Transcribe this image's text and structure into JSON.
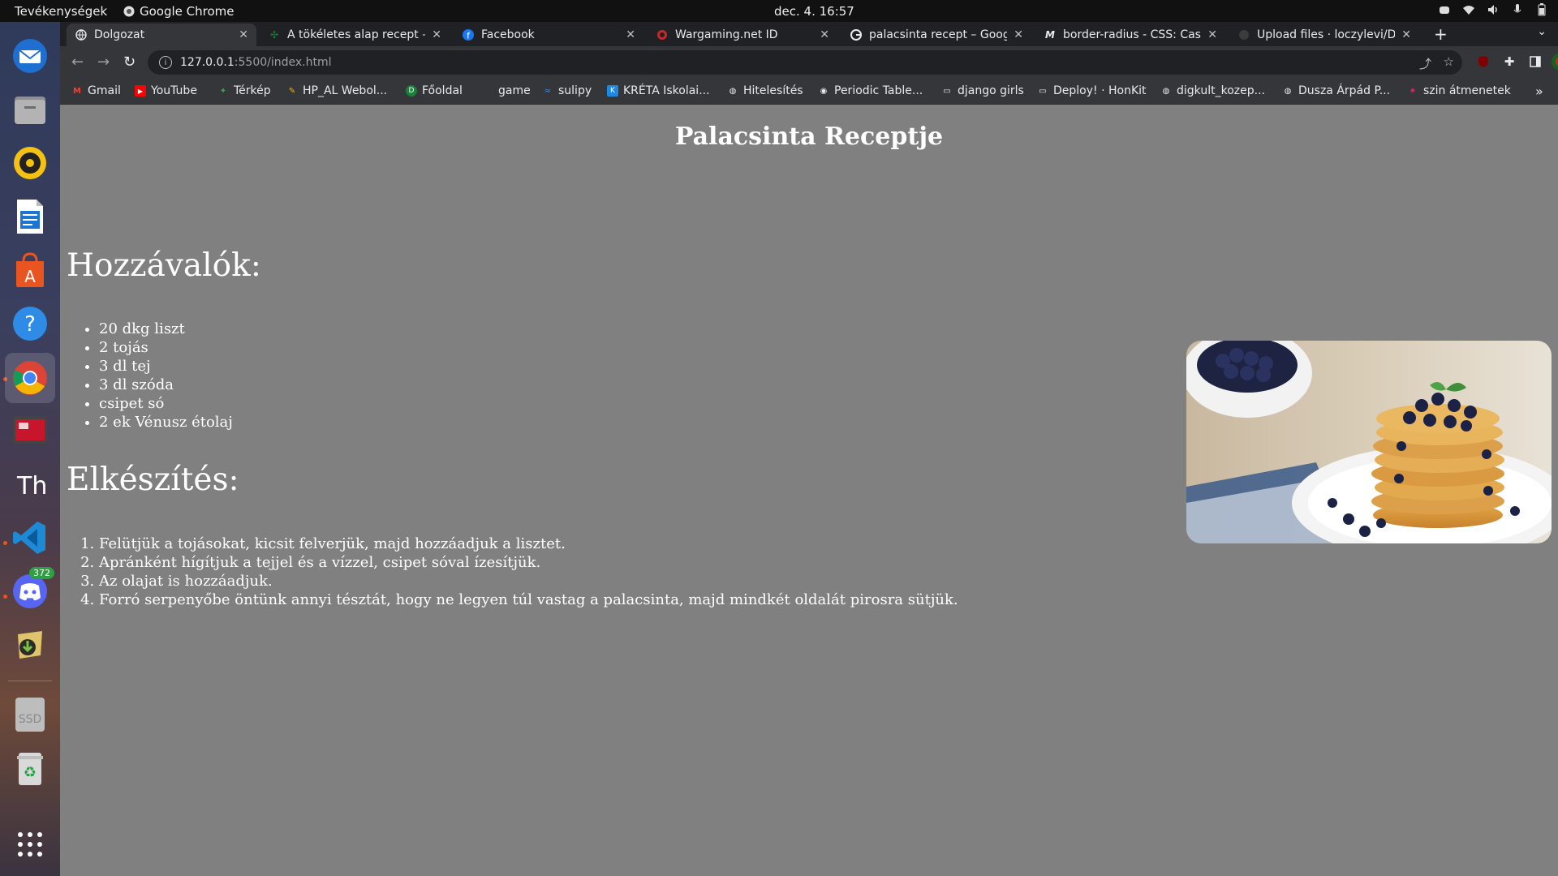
{
  "system": {
    "activities": "Tevékenységek",
    "app_name": "Google Chrome",
    "clock": "dec. 4.  16:57"
  },
  "dock": {
    "discord_badge": "372",
    "ssd_label": "SSD"
  },
  "tabs": [
    {
      "title": "Dolgozat",
      "active": true
    },
    {
      "title": "A tökéletes alap recept – I"
    },
    {
      "title": "Facebook"
    },
    {
      "title": "Wargaming.net ID"
    },
    {
      "title": "palacsinta recept – Googl"
    },
    {
      "title": "border-radius - CSS: Casca"
    },
    {
      "title": "Upload files · loczylevi/Do"
    }
  ],
  "toolbar": {
    "url_host": "127.0.0.1",
    "url_rest": ":5500/index.html"
  },
  "bookmarks": [
    {
      "label": "Gmail",
      "color": "#ea4335",
      "icon": "gmail-icon"
    },
    {
      "label": "YouTube",
      "color": "#ff0000",
      "icon": "youtube-icon"
    },
    {
      "label": "Térkép",
      "color": "#34a853",
      "icon": "maps-icon"
    },
    {
      "label": "HP_AL Webol...",
      "color": "#f4b400",
      "icon": "hp-icon"
    },
    {
      "label": "Főoldal",
      "color": "#1a7f37",
      "icon": "d-icon"
    },
    {
      "label": "game",
      "color": "",
      "icon": ""
    },
    {
      "label": "sulipy",
      "color": "#4285f4",
      "icon": "python-icon"
    },
    {
      "label": "KRÉTA Iskolai...",
      "color": "#1e88e5",
      "icon": "kreta-icon"
    },
    {
      "label": "Hitelesítés",
      "color": "#e8eaed",
      "icon": "globe-icon"
    },
    {
      "label": "Periodic Table...",
      "color": "#e8eaed",
      "icon": "github-icon"
    },
    {
      "label": "django girls",
      "color": "#e8eaed",
      "icon": "doc-icon"
    },
    {
      "label": "Deploy! · HonKit",
      "color": "#e8eaed",
      "icon": "doc-icon"
    },
    {
      "label": "digkult_kozep...",
      "color": "#e8eaed",
      "icon": "globe-icon"
    },
    {
      "label": "Dusza Árpád P...",
      "color": "#e8eaed",
      "icon": "globe-icon"
    },
    {
      "label": "szin átmenetek",
      "color": "#e91e63",
      "icon": "palette-icon"
    }
  ],
  "page": {
    "title": "Palacsinta Receptje",
    "ingredients_title": "Hozzávalók:",
    "ingredients": [
      "20 dkg liszt",
      "2 tojás",
      "3 dl tej",
      "3 dl szóda",
      "csipet só",
      "2 ek Vénusz étolaj"
    ],
    "preparation_title": "Elkészítés:",
    "steps": [
      "Felütjük a tojásokat, kicsit felverjük, majd hozzáadjuk a lisztet.",
      "Apránként hígítjuk a tejjel és a vízzel, csipet sóval ízesítjük.",
      "Az olajat is hozzáadjuk.",
      "Forró serpenyőbe öntünk annyi tésztát, hogy ne legyen túl vastag a palacsinta, majd mindkét oldalát pirosra sütjük."
    ]
  }
}
